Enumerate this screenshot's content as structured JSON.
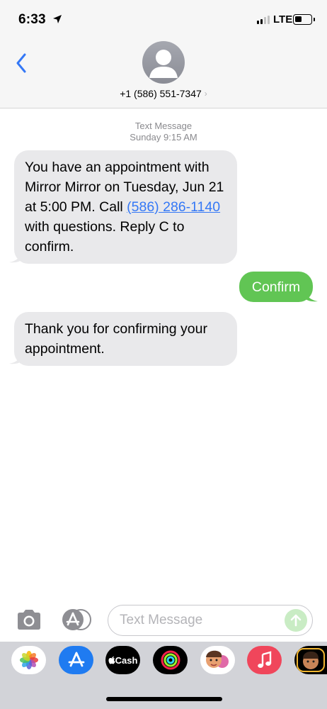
{
  "status_bar": {
    "time": "6:33",
    "network": "LTE",
    "battery_level": 0.38
  },
  "header": {
    "contact": "+1 (586) 551-7347",
    "chevron": "›"
  },
  "thread": {
    "service": "Text Message",
    "timestamp": "Sunday 9:15 AM"
  },
  "messages": [
    {
      "direction": "incoming",
      "text_before_link": "You have an appointment with Mirror Mirror on Tuesday, Jun 21 at 5:00 PM. Call ",
      "link": "(586) 286-1140",
      "text_after_link": " with questions. Reply C to confirm."
    },
    {
      "direction": "outgoing",
      "text": "Confirm"
    },
    {
      "direction": "incoming",
      "text": "Thank you for confirming your appointment."
    }
  ],
  "composer": {
    "placeholder": "Text Message"
  },
  "app_drawer": {
    "apps": [
      {
        "name": "photos-icon"
      },
      {
        "name": "app-store-icon"
      },
      {
        "name": "cash-icon",
        "label": "Cash"
      },
      {
        "name": "activity-icon"
      },
      {
        "name": "memoji-stickers-icon"
      },
      {
        "name": "music-icon"
      },
      {
        "name": "memoji-icon"
      }
    ]
  },
  "colors": {
    "incoming": "#e9e9eb",
    "outgoing": "#61c554",
    "link": "#3478f6",
    "accent": "#1f7bf1"
  }
}
